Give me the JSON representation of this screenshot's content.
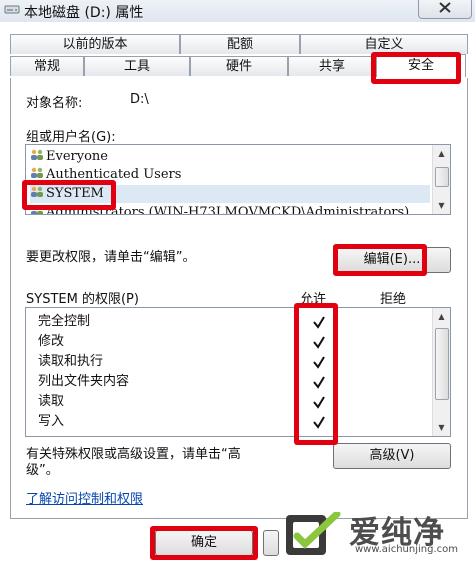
{
  "window": {
    "title": "本地磁盘 (D:) 属性"
  },
  "tabs": {
    "row1": [
      "以前的版本",
      "配额",
      "自定义"
    ],
    "row2": [
      "常规",
      "工具",
      "硬件",
      "共享",
      "安全"
    ],
    "active": "安全"
  },
  "security": {
    "object_label": "对象名称:",
    "object_value": "D:\\",
    "groups_label": "组或用户名(G):",
    "users": [
      "Everyone",
      "Authenticated Users",
      "SYSTEM",
      "Administrators (WIN-H73LMQVMCKD\\Administrators)"
    ],
    "selected_user": "SYSTEM",
    "change_hint": "要更改权限，请单击“编辑”。",
    "edit_button": "编辑(E)...",
    "perm_label": "SYSTEM 的权限(P)",
    "col_allow": "允许",
    "col_deny": "拒绝",
    "permissions": [
      {
        "name": "完全控制",
        "allow": true,
        "deny": false
      },
      {
        "name": "修改",
        "allow": true,
        "deny": false
      },
      {
        "name": "读取和执行",
        "allow": true,
        "deny": false
      },
      {
        "name": "列出文件夹内容",
        "allow": true,
        "deny": false
      },
      {
        "name": "读取",
        "allow": true,
        "deny": false
      },
      {
        "name": "写入",
        "allow": true,
        "deny": false
      }
    ],
    "advanced_hint_1": "有关特殊权限或高级设置，请单击“高",
    "advanced_hint_2": "级”。",
    "advanced_button": "高级(V)",
    "learn_link": "了解访问控制和权限"
  },
  "footer": {
    "ok_button": "确定"
  },
  "watermark": {
    "name": "爱纯净",
    "url": "www.aichunjing.com"
  },
  "colors": {
    "highlight": "#e0000f",
    "link": "#0645ad",
    "selection": "#dde8f5"
  }
}
